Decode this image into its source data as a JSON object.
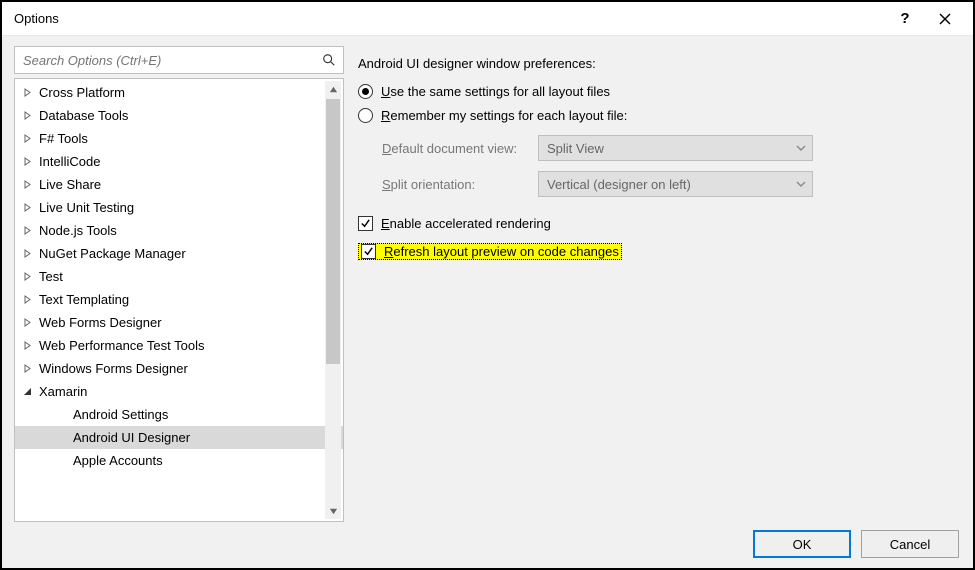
{
  "window": {
    "title": "Options"
  },
  "search": {
    "placeholder": "Search Options (Ctrl+E)"
  },
  "tree": {
    "items": [
      {
        "label": "Cross Platform",
        "expanded": false,
        "depth": 0
      },
      {
        "label": "Database Tools",
        "expanded": false,
        "depth": 0
      },
      {
        "label": "F# Tools",
        "expanded": false,
        "depth": 0
      },
      {
        "label": "IntelliCode",
        "expanded": false,
        "depth": 0
      },
      {
        "label": "Live Share",
        "expanded": false,
        "depth": 0
      },
      {
        "label": "Live Unit Testing",
        "expanded": false,
        "depth": 0
      },
      {
        "label": "Node.js Tools",
        "expanded": false,
        "depth": 0
      },
      {
        "label": "NuGet Package Manager",
        "expanded": false,
        "depth": 0
      },
      {
        "label": "Test",
        "expanded": false,
        "depth": 0
      },
      {
        "label": "Text Templating",
        "expanded": false,
        "depth": 0
      },
      {
        "label": "Web Forms Designer",
        "expanded": false,
        "depth": 0
      },
      {
        "label": "Web Performance Test Tools",
        "expanded": false,
        "depth": 0
      },
      {
        "label": "Windows Forms Designer",
        "expanded": false,
        "depth": 0
      },
      {
        "label": "Xamarin",
        "expanded": true,
        "depth": 0
      },
      {
        "label": "Android Settings",
        "expanded": false,
        "depth": 1
      },
      {
        "label": "Android UI Designer",
        "expanded": false,
        "depth": 1,
        "selected": true
      },
      {
        "label": "Apple Accounts",
        "expanded": false,
        "depth": 1
      }
    ]
  },
  "panel": {
    "heading": "Android UI designer window preferences:",
    "radio1_pre": "U",
    "radio1_post": "se the same settings for all layout files",
    "radio2_pre": "R",
    "radio2_post": "emember my settings for each layout file:",
    "row1_pre": "D",
    "row1_post": "efault document view:",
    "row1_value": "Split View",
    "row2_pre": "S",
    "row2_post": "plit orientation:",
    "row2_value": "Vertical (designer on left)",
    "check1_pre": "E",
    "check1_post": "nable accelerated rendering",
    "check2_pre": "R",
    "check2_post": "efresh layout preview on code changes"
  },
  "buttons": {
    "ok": "OK",
    "cancel": "Cancel"
  }
}
